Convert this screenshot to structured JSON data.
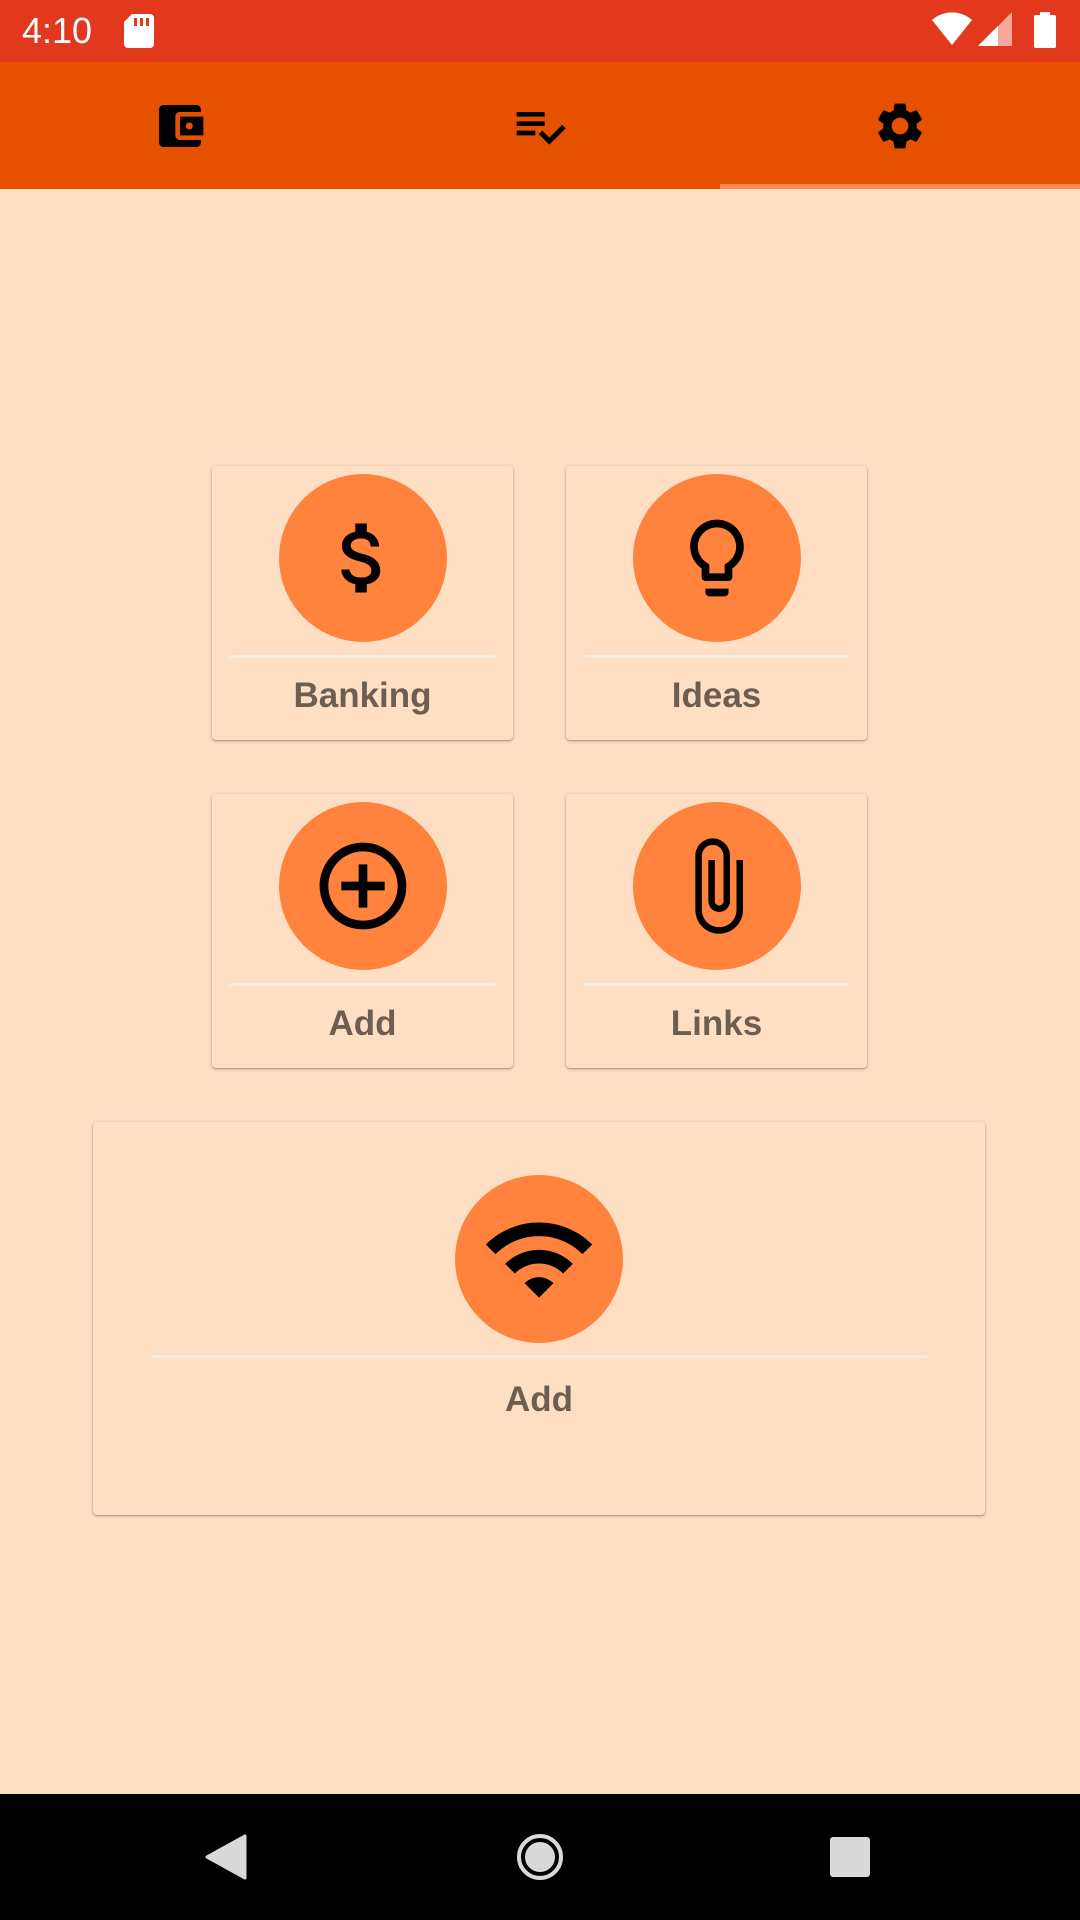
{
  "status_bar": {
    "time": "4:10",
    "icons": [
      "sd-card-icon",
      "wifi-icon",
      "signal-icon",
      "battery-icon"
    ]
  },
  "tabs": [
    {
      "icon": "wallet-icon",
      "selected": false
    },
    {
      "icon": "checklist-icon",
      "selected": false
    },
    {
      "icon": "gear-icon",
      "selected": true
    }
  ],
  "cards": {
    "banking": {
      "label": "Banking",
      "icon": "dollar-icon"
    },
    "ideas": {
      "label": "Ideas",
      "icon": "lightbulb-icon"
    },
    "add": {
      "label": "Add",
      "icon": "add-circle-icon"
    },
    "links": {
      "label": "Links",
      "icon": "paperclip-icon"
    },
    "wifi_add": {
      "label": "Add",
      "icon": "wifi-icon"
    }
  },
  "nav_bar": {
    "buttons": [
      "back-icon",
      "home-icon",
      "recents-icon"
    ]
  },
  "colors": {
    "status_bar": "#e1381e",
    "tab_bar": "#e65100",
    "tab_indicator": "#ff8a50",
    "background": "#ffdfc4",
    "icon_circle": "#ff833d",
    "label_text": "#6e5e52"
  }
}
